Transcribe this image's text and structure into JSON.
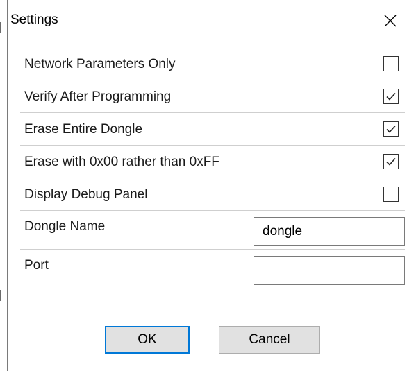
{
  "dialog": {
    "title": "Settings"
  },
  "options": [
    {
      "label": "Network Parameters Only",
      "checked": false
    },
    {
      "label": "Verify After Programming",
      "checked": true
    },
    {
      "label": "Erase Entire Dongle",
      "checked": true
    },
    {
      "label": "Erase with 0x00 rather than 0xFF",
      "checked": true
    },
    {
      "label": "Display Debug Panel",
      "checked": false
    }
  ],
  "fields": {
    "dongle_name": {
      "label": "Dongle Name",
      "value": "dongle"
    },
    "port": {
      "label": "Port",
      "value": ""
    }
  },
  "buttons": {
    "ok": "OK",
    "cancel": "Cancel"
  },
  "icons": {
    "close": "close-icon",
    "check": "checkmark-icon"
  },
  "colors": {
    "ok_border": "#0078d7",
    "button_bg": "#e1e1e1"
  }
}
